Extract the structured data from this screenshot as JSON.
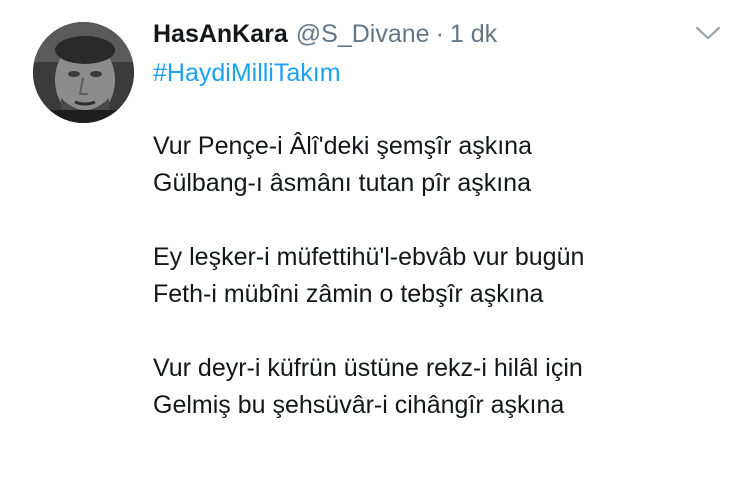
{
  "tweet": {
    "author": {
      "name": "HasAnKara",
      "handle": "@S_Divane"
    },
    "separator": "·",
    "time": "1 dk",
    "hashtag": "#HaydiMilliTakım",
    "stanzas": [
      [
        "Vur Pençe-i Âlî'deki şemşîr aşkına",
        "Gülbang-ı âsmânı tutan pîr aşkına"
      ],
      [
        "Ey leşker-i müfettihü'l-ebvâb vur bugün",
        "Feth-i mübîni zâmin o tebşîr aşkına"
      ],
      [
        "Vur deyr-i küfrün üstüne rekz-i hilâl için",
        "Gelmiş bu şehsüvâr-i cihângîr aşkına"
      ]
    ]
  },
  "icons": {
    "avatar": "profile-photo",
    "menu": "chevron-down-icon"
  },
  "colors": {
    "text": "#14171a",
    "muted": "#657786",
    "link": "#1da1f2",
    "background": "#ffffff"
  }
}
